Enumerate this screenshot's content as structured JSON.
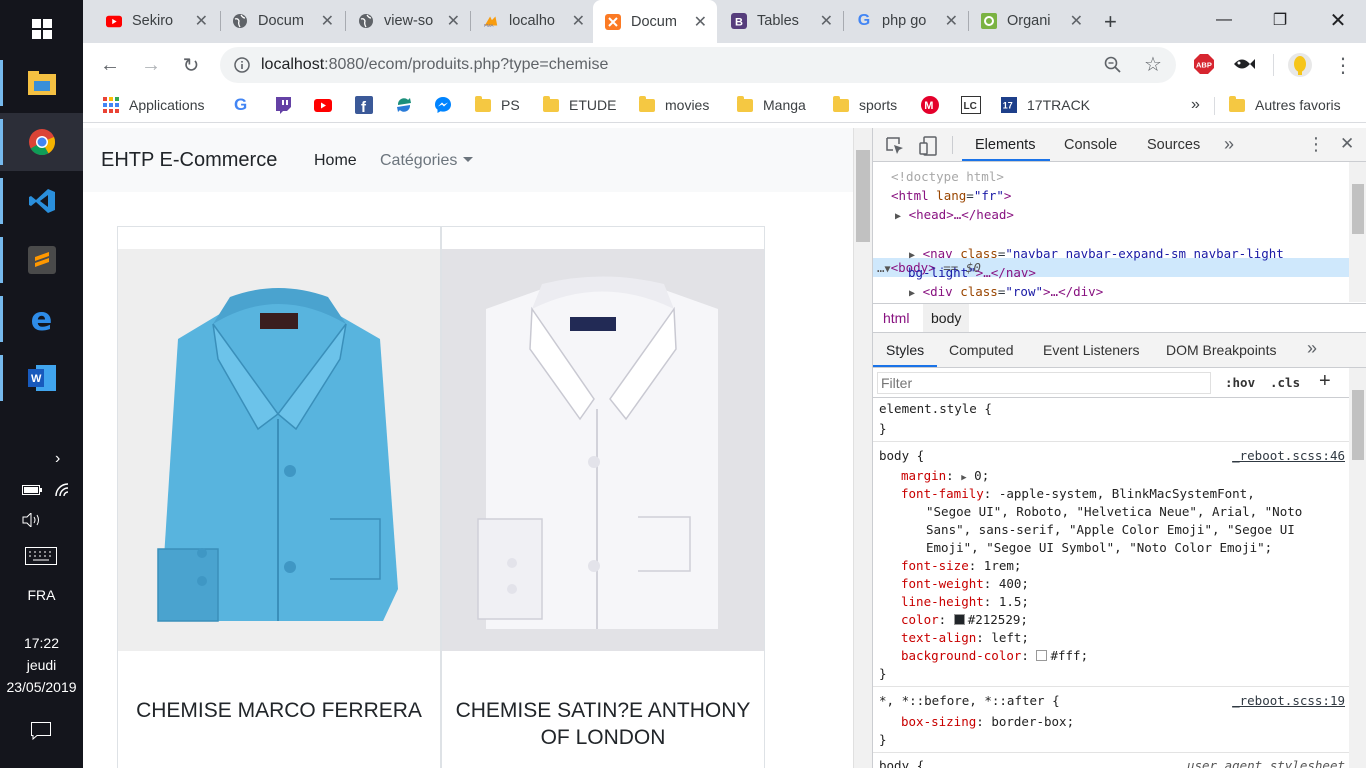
{
  "taskbar": {
    "language": "FRA",
    "time": "17:22",
    "day": "jeudi",
    "date": "23/05/2019"
  },
  "tabs": [
    {
      "label": "Sekiro",
      "icon": "youtube-icon"
    },
    {
      "label": "Docum",
      "icon": "globe-icon"
    },
    {
      "label": "view-so",
      "icon": "globe-icon"
    },
    {
      "label": "localho",
      "icon": "phpmyadmin-icon"
    },
    {
      "label": "Docum",
      "icon": "xampp-icon",
      "active": true
    },
    {
      "label": "Tables",
      "icon": "bootstrap-icon"
    },
    {
      "label": "php go",
      "icon": "google-icon"
    },
    {
      "label": "Organi",
      "icon": "green-app-icon"
    }
  ],
  "address": {
    "host": "localhost",
    "rest": ":8080/ecom/produits.php?type=chemise"
  },
  "bookmarks": {
    "applications": "Applications",
    "items": [
      "PS",
      "ETUDE",
      "movies",
      "Manga",
      "sports"
    ],
    "track": "17TRACK",
    "others": "Autres favoris"
  },
  "page": {
    "brand": "EHTP E-Commerce",
    "nav_home": "Home",
    "nav_categories": "Catégories",
    "products": [
      {
        "title": "CHEMISE MARCO FERRERA",
        "color": "#58b4de"
      },
      {
        "title": "CHEMISE SATIN?E ANTHONY OF LONDON",
        "color": "#f4f4f7"
      }
    ]
  },
  "devtools": {
    "tabs": [
      "Elements",
      "Console",
      "Sources"
    ],
    "crumbs": [
      "html",
      "body"
    ],
    "subtabs": [
      "Styles",
      "Computed",
      "Event Listeners",
      "DOM Breakpoints"
    ],
    "filter_placeholder": "Filter",
    "hov": ":hov",
    "cls": ".cls",
    "dom": {
      "doctype": "<!doctype html>",
      "html_open": "<html",
      "html_attr": "lang",
      "html_val": "\"fr\"",
      "head": "<head>…</head>",
      "body": "<body>",
      "body_eq": "== $0",
      "nav_tag": "<nav",
      "nav_attr": "class",
      "nav_val": "\"navbar navbar-expand-sm navbar-light",
      "nav_val2": "bg-light\"",
      "nav_end": ">…</nav>",
      "div_tag": "<div",
      "div_attr": "class",
      "div_val": "\"row\"",
      "div_end": ">…</div>"
    },
    "styles": {
      "element_style": "element.style {",
      "close": "}",
      "body_selector": "body {",
      "reboot46": "_reboot.scss:46",
      "margin": "margin",
      "margin_val": "0;",
      "font_family": "font-family",
      "ff_val1": "-apple-system, BlinkMacSystemFont,",
      "ff_val2": "\"Segoe UI\", Roboto, \"Helvetica Neue\", Arial, \"Noto",
      "ff_val3": "Sans\", sans-serif, \"Apple Color Emoji\", \"Segoe UI",
      "ff_val4": "Emoji\", \"Segoe UI Symbol\", \"Noto Color Emoji\";",
      "font_size": "font-size",
      "font_size_val": "1rem;",
      "font_weight": "font-weight",
      "font_weight_val": "400;",
      "line_height": "line-height",
      "line_height_val": "1.5;",
      "color": "color",
      "color_val": "#212529;",
      "text_align": "text-align",
      "text_align_val": "left;",
      "bg_color": "background-color",
      "bg_color_val": "#fff;",
      "universal_selector": "*, *::before, *::after {",
      "reboot19": "_reboot.scss:19",
      "box_sizing": "box-sizing",
      "box_sizing_val": "border-box;",
      "last_selector": "body {",
      "last_source": "user agent stylesheet"
    }
  },
  "colors": {
    "accent": "#1a73e8",
    "taskbar": "#14151c",
    "tabstrip": "#dee1e6"
  }
}
